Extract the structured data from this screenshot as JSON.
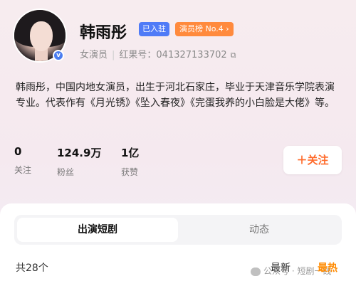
{
  "profile": {
    "name": "韩雨彤",
    "badge_joined": "已入驻",
    "badge_rank": "演员榜 No.4 ›",
    "role": "女演员",
    "redbook_id": "红果号：041327133702",
    "copy_icon": "⧉",
    "verify_icon": "v",
    "bio": "韩雨彤，中国内地女演员，出生于河北石家庄，毕业于天津音乐学院表演专业。代表作有《月光锈》《坠入春夜》《完蛋我养的小白脸是大佬》等。"
  },
  "stats": [
    {
      "value": "0",
      "label": "关注"
    },
    {
      "value": "124.9万",
      "label": "粉丝"
    },
    {
      "value": "1亿",
      "label": "获赞"
    }
  ],
  "follow_button": "＋关注",
  "tabs": [
    {
      "label": "出演短剧",
      "active": true
    },
    {
      "label": "动态",
      "active": false
    }
  ],
  "list": {
    "count": "共28个",
    "sort_new": "最新",
    "sort_hot": "最热"
  },
  "watermark": "公众号 · 短剧一线",
  "colors": {
    "accent_orange": "#ff6a2a",
    "badge_blue": "#4f7bf7",
    "badge_orange": "#ff8a3d"
  }
}
